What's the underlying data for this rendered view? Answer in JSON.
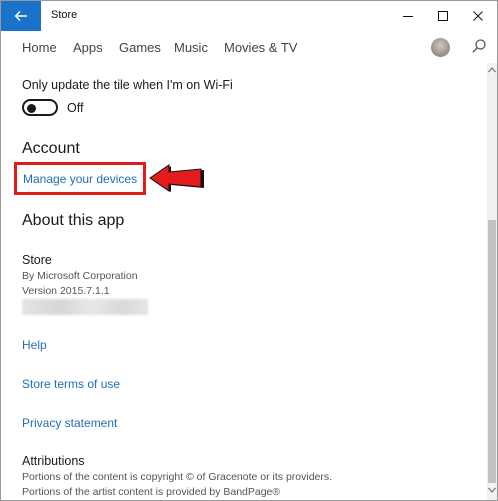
{
  "window": {
    "title": "Store",
    "back_icon": "back-arrow-icon",
    "accent_color": "#1a73c9"
  },
  "nav": {
    "items": [
      "Home",
      "Apps",
      "Games",
      "Music",
      "Movies & TV"
    ]
  },
  "settings": {
    "tile_wifi_label": "Only update the tile when I'm on Wi-Fi",
    "tile_wifi_state": "Off"
  },
  "account": {
    "heading": "Account",
    "manage_devices_link": "Manage your devices",
    "annotation_color": "#e31b1b"
  },
  "about": {
    "heading": "About this app",
    "app_name": "Store",
    "publisher": "By Microsoft Corporation",
    "version": "Version 2015.7.1.1",
    "help_link": "Help",
    "terms_link": "Store terms of use",
    "privacy_link": "Privacy statement"
  },
  "attributions": {
    "heading": "Attributions",
    "line1": "Portions of the content is copyright © of Gracenote or its providers.",
    "line2": "Portions of the artist content is provided by BandPage®"
  },
  "link_color": "#1e6fb8"
}
